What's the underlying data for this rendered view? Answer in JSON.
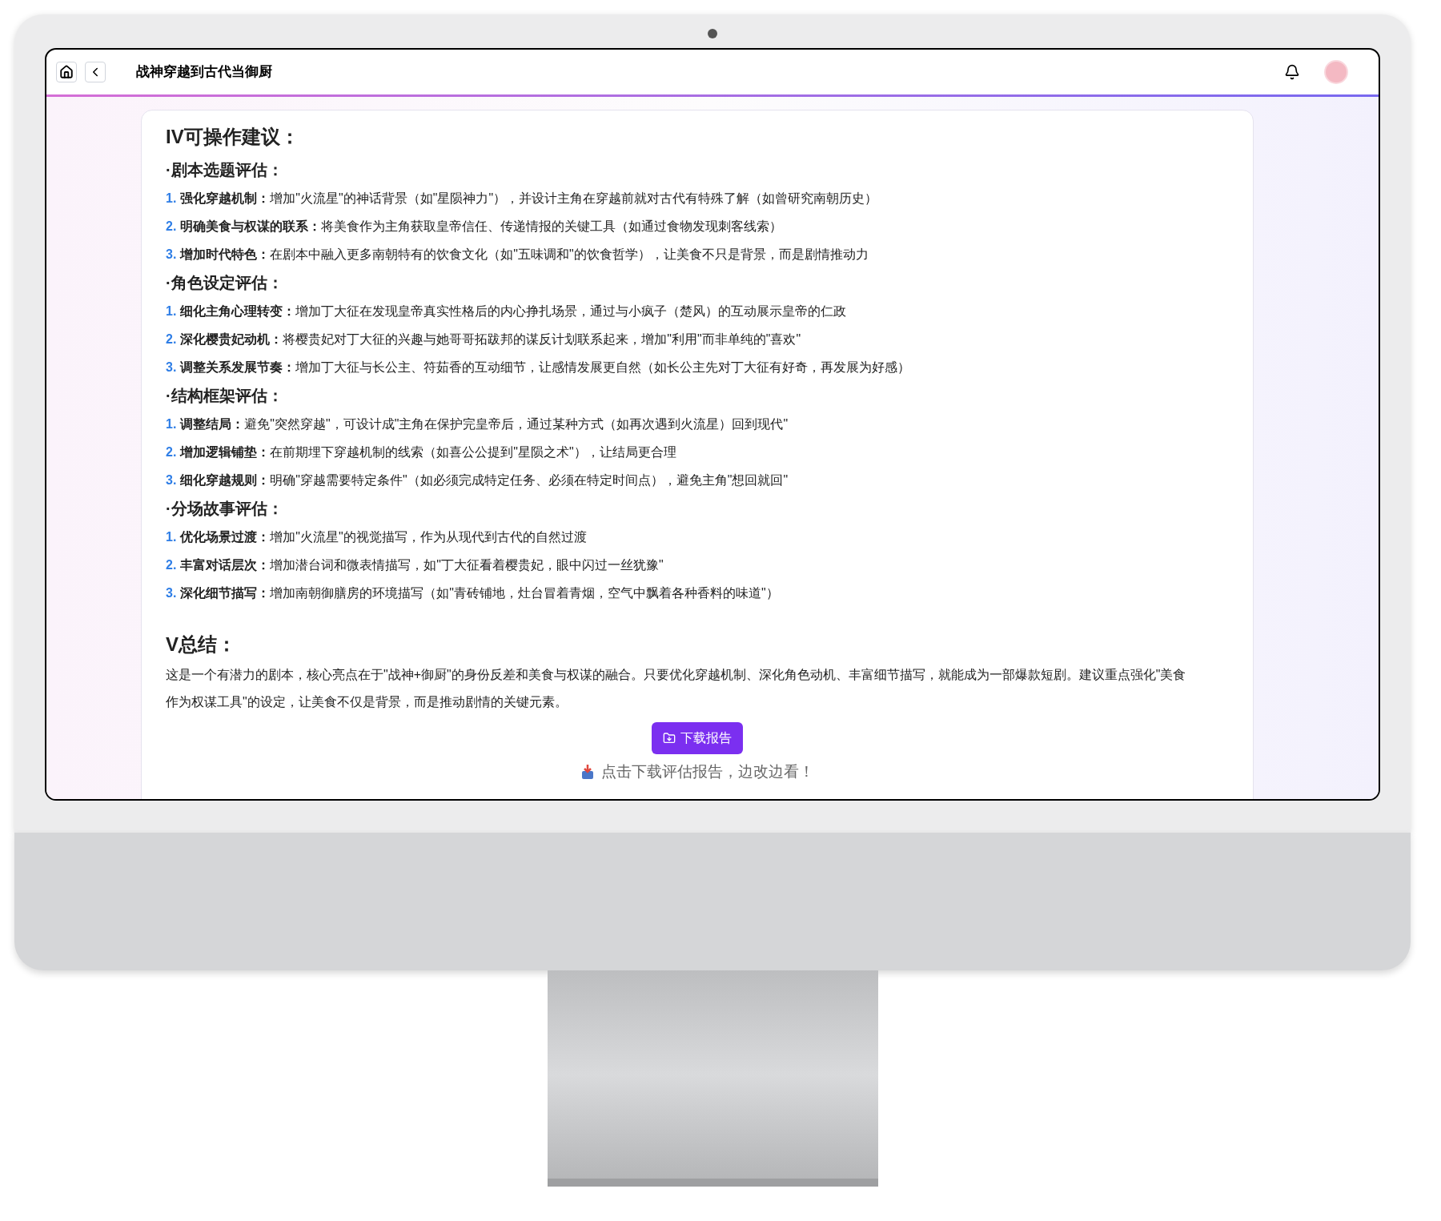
{
  "header": {
    "title": "战神穿越到古代当御厨"
  },
  "report": {
    "title": "IV可操作建议：",
    "sections": [
      {
        "heading": "·剧本选题评估：",
        "items": [
          {
            "number": "1.",
            "label": "强化穿越机制：",
            "text": "增加\"火流星\"的神话背景（如\"星陨神力\"），并设计主角在穿越前就对古代有特殊了解（如曾研究南朝历史）"
          },
          {
            "number": "2.",
            "label": "明确美食与权谋的联系：",
            "text": "将美食作为主角获取皇帝信任、传递情报的关键工具（如通过食物发现刺客线索）"
          },
          {
            "number": "3.",
            "label": "增加时代特色：",
            "text": "在剧本中融入更多南朝特有的饮食文化（如\"五味调和\"的饮食哲学），让美食不只是背景，而是剧情推动力"
          }
        ]
      },
      {
        "heading": "·角色设定评估：",
        "items": [
          {
            "number": "1.",
            "label": "细化主角心理转变：",
            "text": "增加丁大征在发现皇帝真实性格后的内心挣扎场景，通过与小疯子（楚风）的互动展示皇帝的仁政"
          },
          {
            "number": "2.",
            "label": "深化樱贵妃动机：",
            "text": "将樱贵妃对丁大征的兴趣与她哥哥拓跋邦的谋反计划联系起来，增加\"利用\"而非单纯的\"喜欢\""
          },
          {
            "number": "3.",
            "label": "调整关系发展节奏：",
            "text": "增加丁大征与长公主、符茹香的互动细节，让感情发展更自然（如长公主先对丁大征有好奇，再发展为好感）"
          }
        ]
      },
      {
        "heading": "·结构框架评估：",
        "items": [
          {
            "number": "1.",
            "label": "调整结局：",
            "text": "避免\"突然穿越\"，可设计成\"主角在保护完皇帝后，通过某种方式（如再次遇到火流星）回到现代\""
          },
          {
            "number": "2.",
            "label": "增加逻辑铺垫：",
            "text": "在前期埋下穿越机制的线索（如喜公公提到\"星陨之术\"），让结局更合理"
          },
          {
            "number": "3.",
            "label": "细化穿越规则：",
            "text": "明确\"穿越需要特定条件\"（如必须完成特定任务、必须在特定时间点），避免主角\"想回就回\""
          }
        ]
      },
      {
        "heading": "·分场故事评估：",
        "items": [
          {
            "number": "1.",
            "label": "优化场景过渡：",
            "text": "增加\"火流星\"的视觉描写，作为从现代到古代的自然过渡"
          },
          {
            "number": "2.",
            "label": "丰富对话层次：",
            "text": "增加潜台词和微表情描写，如\"丁大征看着樱贵妃，眼中闪过一丝犹豫\""
          },
          {
            "number": "3.",
            "label": "深化细节描写：",
            "text": "增加南朝御膳房的环境描写（如\"青砖铺地，灶台冒着青烟，空气中飘着各种香料的味道\"）"
          }
        ]
      }
    ],
    "summary": {
      "heading": "V总结：",
      "paragraph": "这是一个有潜力的剧本，核心亮点在于\"战神+御厨\"的身份反差和美食与权谋的融合。只要优化穿越机制、深化角色动机、丰富细节描写，就能成为一部爆款短剧。建议重点强化\"美食作为权谋工具\"的设定，让美食不仅是背景，而是推动剧情的关键元素。"
    },
    "download_button": {
      "label": "下载报告"
    },
    "hint": {
      "text": "点击下载评估报告，边改边看！"
    }
  }
}
